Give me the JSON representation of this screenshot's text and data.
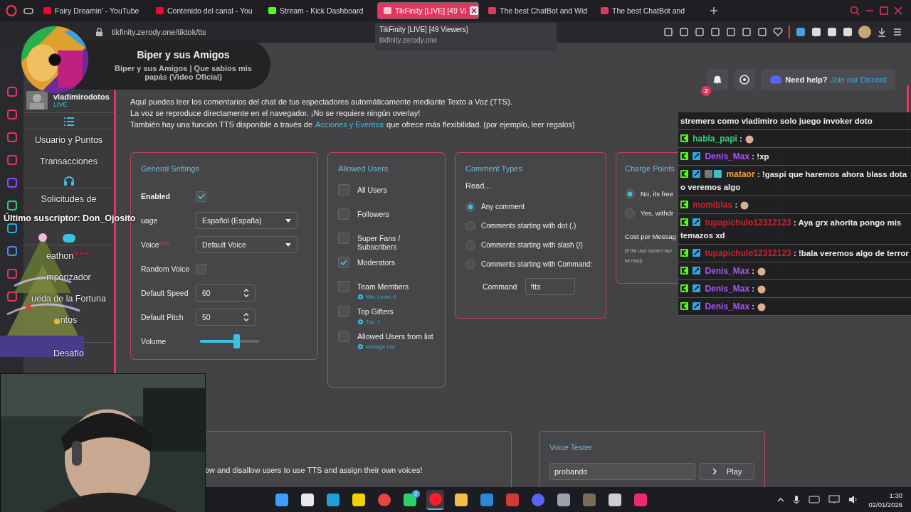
{
  "browser": {
    "tabs": [
      {
        "title": "Fairy Dreamin' - YouTube",
        "kind": "youtube",
        "selected": false
      },
      {
        "title": "Contenido del canal - You",
        "kind": "youtube",
        "selected": false
      },
      {
        "title": "Stream - Kick Dashboard",
        "kind": "kick",
        "selected": false
      },
      {
        "title": "TikFinity [LIVE] [49 Vi",
        "kind": "tikfinity",
        "selected": true
      },
      {
        "title": "The best ChatBot and Wid",
        "kind": "tikfinity",
        "selected": false
      },
      {
        "title": "The best ChatBot and ",
        "kind": "tikfinity",
        "selected": false
      }
    ],
    "tooltip": {
      "title": "TikFinity [LIVE] [49 Viewers]",
      "url": "tikfinity.zerody.one"
    },
    "address": "tikfinity.zerody.one/tiktok/tts"
  },
  "sidebar": {
    "user": {
      "name": "vladimirodotos",
      "status": "LIVE"
    },
    "items": [
      {
        "kind": "list"
      },
      {
        "kind": "link",
        "label": "Usuario y Puntos"
      },
      {
        "kind": "link",
        "label": "Transacciones"
      },
      {
        "kind": "headphones"
      },
      {
        "kind": "link",
        "label": "Solicitudes de"
      },
      {
        "kind": "gamepad"
      },
      {
        "kind": "link",
        "label": "eathon",
        "badge": "NUEVO"
      },
      {
        "kind": "link",
        "label": "mporizador"
      },
      {
        "kind": "link",
        "label": "ueda de la Fortuna"
      },
      {
        "kind": "link",
        "label": "ntos"
      },
      {
        "kind": "spacer"
      },
      {
        "kind": "link",
        "label": "Desafío"
      }
    ]
  },
  "header": {
    "notifications": "2",
    "help_label": "Need help?",
    "help_link": "Join our Discord"
  },
  "intro": [
    {
      "text": "Aquí puedes leer los comentarios del chat de tus espectadores automáticamente mediante Texto a Voz (TTS)."
    },
    {
      "text": "La voz se reproduce directamente en el navegador. ¡No se requiere ningún overlay!"
    },
    {
      "text": "También hay una función TTS disponible a través de",
      "link": "Acciones y Eventos",
      "after": "que ofrece más flexibilidad. (por ejemplo, leer regalos)"
    }
  ],
  "general_settings": {
    "title": "General Settings",
    "rows": [
      {
        "kind": "checkbox",
        "label": "Enabled",
        "bold": true,
        "checked": true
      },
      {
        "kind": "select",
        "label": "uage",
        "value": "Español (España)"
      },
      {
        "kind": "select",
        "label": "Voice",
        "badge": "NEW!",
        "value": "Default Voice"
      },
      {
        "kind": "checkbox",
        "label": "Random Voice",
        "bold": false,
        "checked": false
      },
      {
        "kind": "number",
        "label": "Default Speed",
        "value": "60"
      },
      {
        "kind": "number",
        "label": "Default Pitch",
        "value": "50"
      },
      {
        "kind": "slider",
        "label": "Volume",
        "level": 0.63
      }
    ]
  },
  "allowed_users": {
    "title": "Allowed Users",
    "items": [
      {
        "label": "All Users",
        "checked": false
      },
      {
        "label": "Followers",
        "checked": false
      },
      {
        "label": "Super Fans / Subscribers",
        "checked": false
      },
      {
        "label": "Moderators",
        "checked": true
      },
      {
        "label": "Team Members",
        "checked": false,
        "setting": "Min. Level: 6"
      },
      {
        "label": "Top Gifters",
        "checked": false,
        "setting": "Top: 1"
      },
      {
        "label": "Allowed Users from list",
        "checked": false,
        "setting": "Manage List"
      }
    ]
  },
  "comment_types": {
    "title": "Comment Types",
    "intro": "Read...",
    "options": [
      {
        "label": "Any comment",
        "selected": true
      },
      {
        "label": "Comments starting with dot (.)",
        "selected": false
      },
      {
        "label": "Comments starting with slash (/)",
        "selected": false
      },
      {
        "label": "Comments starting with Command:",
        "selected": false
      }
    ],
    "command_label": "Command",
    "command_value": "!tts"
  },
  "charge_points": {
    "title": "Charge Points",
    "options": [
      {
        "label": "No, its free",
        "selected": true
      },
      {
        "label": "Yes, withdr",
        "selected": false
      }
    ],
    "cost_label": "Cost per Messag",
    "note": "(If the user doesn't hav",
    "note_end": "be read)"
  },
  "user_voices": {
    "text": "ow and disallow users to use TTS and assign their own voices!"
  },
  "voice_tester": {
    "title": "Voice Tester",
    "value": "probando",
    "button": "Play"
  },
  "now_playing": {
    "title": "Biper y sus Amigos",
    "subtitle": "Biper y sus Amigos | Que sabios mis papás (Video Oficial)"
  },
  "subscriber_alert": "Último suscriptor: Don_Ojosito",
  "chat": [
    {
      "text": "stremers como vladimiro solo juego invoker doto"
    },
    {
      "user": "habla_papi",
      "color": "#2fd07a",
      "kick": true,
      "mod": false,
      "extra": false,
      "text": ":",
      "emote": true
    },
    {
      "user": "Denis_Max",
      "color": "#a855f7",
      "kick": true,
      "mod": true,
      "extra": false,
      "text": ": !xp",
      "emote": false
    },
    {
      "user": "mataor",
      "color": "#f0a030",
      "kick": true,
      "mod": true,
      "extra": true,
      "text": ": !gaspi que haremos ahora blass dota o veremos algo",
      "emote": false
    },
    {
      "user": "momiblas",
      "color": "#d0202c",
      "kick": true,
      "mod": false,
      "extra": false,
      "text": ":",
      "emote": true
    },
    {
      "user": "tupapichulo12312123",
      "color": "#d0202c",
      "kick": true,
      "mod": true,
      "extra": false,
      "text": ": Aya grx ahorita pongo mis temazos xd",
      "emote": false
    },
    {
      "user": "tupapichulo12312123",
      "color": "#d0202c",
      "kick": true,
      "mod": true,
      "extra": false,
      "text": ": !bala veremos algo de terror",
      "emote": false
    },
    {
      "user": "Denis_Max",
      "color": "#a855f7",
      "kick": true,
      "mod": true,
      "extra": false,
      "text": ":",
      "emote": true
    },
    {
      "user": "Denis_Max",
      "color": "#a855f7",
      "kick": true,
      "mod": true,
      "extra": false,
      "text": ":",
      "emote": true
    },
    {
      "user": "Denis_Max",
      "color": "#a855f7",
      "kick": true,
      "mod": true,
      "extra": false,
      "text": ":",
      "emote": true
    }
  ],
  "taskbar": {
    "apps": [
      {
        "kind": "windows",
        "selected": false
      },
      {
        "kind": "search",
        "selected": false
      },
      {
        "kind": "edge",
        "selected": false
      },
      {
        "kind": "notes",
        "selected": false
      },
      {
        "kind": "chrome",
        "selected": false
      },
      {
        "kind": "whatsapp",
        "selected": false,
        "badge": "2"
      },
      {
        "kind": "opera",
        "selected": true
      },
      {
        "kind": "files",
        "selected": false
      },
      {
        "kind": "store",
        "selected": false
      },
      {
        "kind": "red-app",
        "selected": false
      },
      {
        "kind": "discord",
        "selected": false
      },
      {
        "kind": "steam",
        "selected": false
      },
      {
        "kind": "box",
        "selected": false
      },
      {
        "kind": "obs",
        "selected": false
      },
      {
        "kind": "tiktok",
        "selected": false
      }
    ],
    "time": "1:30",
    "date": "02/01/2026"
  }
}
